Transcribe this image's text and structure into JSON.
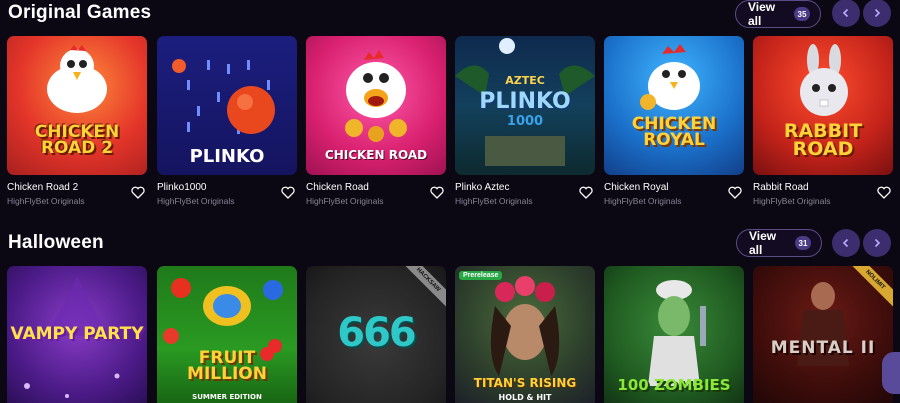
{
  "sections": [
    {
      "title": "Original Games",
      "view_all": "View all",
      "count": "35",
      "games": [
        {
          "name": "Chicken Road 2",
          "provider": "HighFlyBet Originals",
          "art": "CHICKEN ROAD 2"
        },
        {
          "name": "Plinko1000",
          "provider": "HighFlyBet Originals",
          "art": "PLINKO"
        },
        {
          "name": "Chicken Road",
          "provider": "HighFlyBet Originals",
          "art": "CHICKEN ROAD"
        },
        {
          "name": "Plinko Aztec",
          "provider": "HighFlyBet Originals",
          "art_top": "AZTEC",
          "art": "PLINKO",
          "art_sub": "1000"
        },
        {
          "name": "Chicken Royal",
          "provider": "HighFlyBet Originals",
          "art": "CHICKEN ROYAL"
        },
        {
          "name": "Rabbit Road",
          "provider": "HighFlyBet Originals",
          "art": "RABBIT ROAD"
        }
      ]
    },
    {
      "title": "Halloween",
      "view_all": "View all",
      "count": "31",
      "games": [
        {
          "art": "VAMPY PARTY"
        },
        {
          "art": "FRUIT MILLION",
          "art_sub": "SUMMER EDITION"
        },
        {
          "art": "666",
          "ribbon": "HACKSAW"
        },
        {
          "art": "TITAN'S RISING",
          "art_sub": "HOLD & HIT",
          "tag": "Prerelease"
        },
        {
          "art": "100 ZOMBIES"
        },
        {
          "art": "MENTAL II",
          "ribbon": "NOLIMIT"
        }
      ]
    }
  ],
  "icons": {
    "prev": "chevron-left-icon",
    "next": "chevron-right-icon",
    "favorite": "heart-icon"
  },
  "colors": {
    "background": "#0b0713",
    "accent": "#3c2e6e",
    "badge": "#4b3a86"
  }
}
